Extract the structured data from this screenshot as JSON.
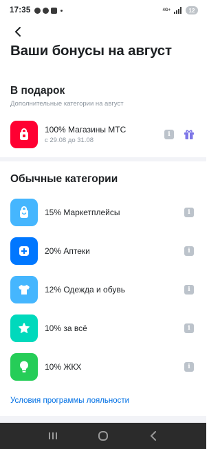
{
  "status_bar": {
    "time": "17:35",
    "network": "4G+",
    "battery": "12"
  },
  "header": {
    "back_icon": "chevron-left-icon",
    "title": "Ваши бонусы на август"
  },
  "gift": {
    "title": "В подарок",
    "subtitle": "Дополнительные категории на август",
    "item": {
      "label": "100% Магазины МТС",
      "dates": "с 29.08 до 31.08",
      "icon": "shopping-bag-icon",
      "color": "#ff0032"
    }
  },
  "regular": {
    "title": "Обычные категории",
    "items": [
      {
        "label": "15% Маркетплейсы",
        "icon": "bag-icon",
        "color": "#45b6fe"
      },
      {
        "label": "20% Аптеки",
        "icon": "pharmacy-icon",
        "color": "#0077ff"
      },
      {
        "label": "12% Одежда и обувь",
        "icon": "tshirt-icon",
        "color": "#45b6fe"
      },
      {
        "label": "10% за всё",
        "icon": "star-icon",
        "color": "#00d9bc"
      },
      {
        "label": "10% ЖКХ",
        "icon": "lightbulb-icon",
        "color": "#26cd58"
      }
    ]
  },
  "footer": {
    "link": "Условия программы лояльности"
  },
  "colors": {
    "link": "#0070e5",
    "secondary_text": "#8d969f",
    "gift_accent": "#7d76e7"
  }
}
